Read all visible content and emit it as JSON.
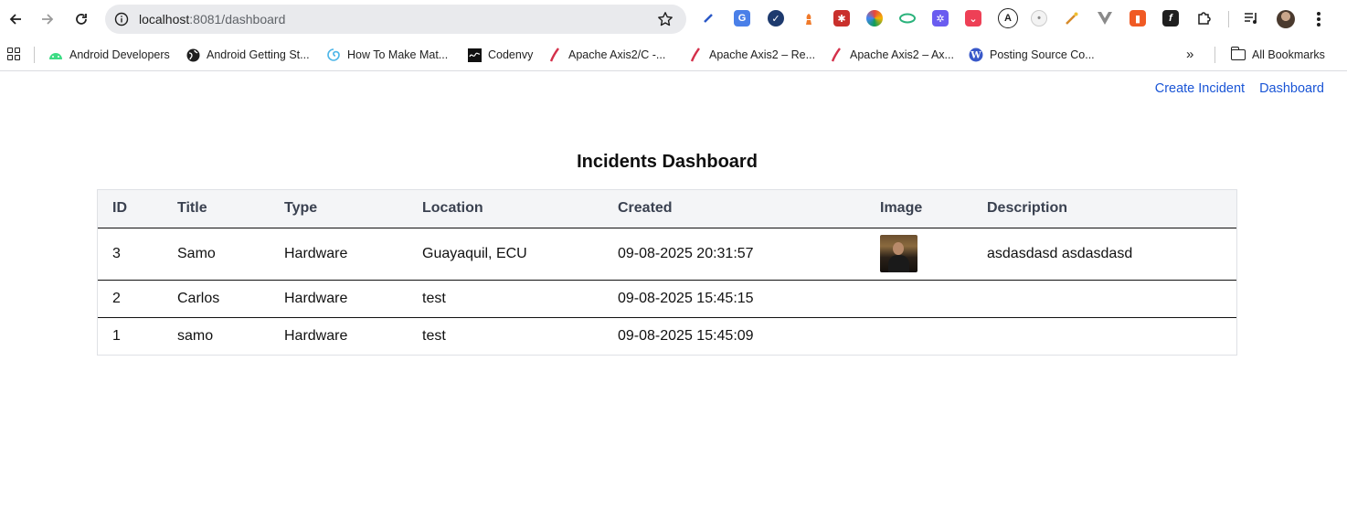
{
  "browser": {
    "url_host": "localhost",
    "url_path": ":8081/dashboard"
  },
  "bookmarks": [
    {
      "label": "Android Developers",
      "icon": "android-icon"
    },
    {
      "label": "Android Getting St...",
      "icon": "globe-icon"
    },
    {
      "label": "How To Make Mat...",
      "icon": "swirl-icon"
    },
    {
      "label": "Codenvy",
      "icon": "codenvy-icon"
    },
    {
      "label": "Apache Axis2/C -...",
      "icon": "feather-icon"
    },
    {
      "label": "Apache Axis2 – Re...",
      "icon": "feather-icon"
    },
    {
      "label": "Apache Axis2 – Ax...",
      "icon": "feather-icon"
    },
    {
      "label": "Posting Source Co...",
      "icon": "wordpress-icon"
    }
  ],
  "all_bookmarks_label": "All Bookmarks",
  "nav": {
    "create_incident": "Create Incident",
    "dashboard": "Dashboard"
  },
  "page_title": "Incidents Dashboard",
  "table": {
    "headers": [
      "ID",
      "Title",
      "Type",
      "Location",
      "Created",
      "Image",
      "Description"
    ],
    "rows": [
      {
        "id": "3",
        "title": "Samo",
        "type": "Hardware",
        "location": "Guayaquil, ECU",
        "created": "09-08-2025 20:31:57",
        "has_image": true,
        "description": "asdasdasd asdasdasd"
      },
      {
        "id": "2",
        "title": "Carlos",
        "type": "Hardware",
        "location": "test",
        "created": "09-08-2025 15:45:15",
        "has_image": false,
        "description": ""
      },
      {
        "id": "1",
        "title": "samo",
        "type": "Hardware",
        "location": "test",
        "created": "09-08-2025 15:45:09",
        "has_image": false,
        "description": ""
      }
    ]
  },
  "colors": {
    "link": "#1a55d6",
    "header_bg": "#f4f5f7"
  }
}
